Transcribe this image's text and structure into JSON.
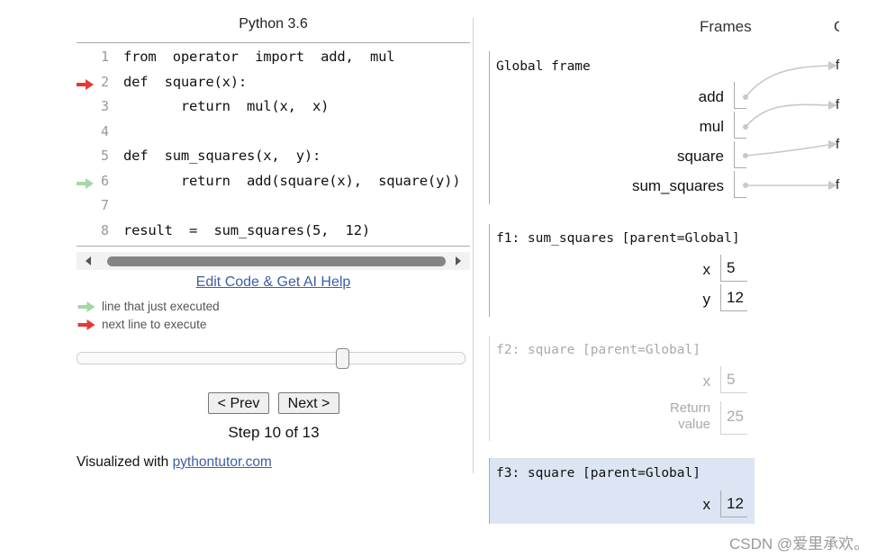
{
  "code_panel": {
    "language_title": "Python 3.6",
    "lines": [
      {
        "num": "1",
        "text": "from  operator  import  add,  mul",
        "arrow": "none"
      },
      {
        "num": "2",
        "text": "def  square(x):",
        "arrow": "next"
      },
      {
        "num": "3",
        "text": "       return  mul(x,  x)",
        "arrow": "none"
      },
      {
        "num": "4",
        "text": "",
        "arrow": "none"
      },
      {
        "num": "5",
        "text": "def  sum_squares(x,  y):",
        "arrow": "none"
      },
      {
        "num": "6",
        "text": "       return  add(square(x),  square(y))",
        "arrow": "just_executed"
      },
      {
        "num": "7",
        "text": "",
        "arrow": "none"
      },
      {
        "num": "8",
        "text": "result  =  sum_squares(5,  12)",
        "arrow": "none"
      }
    ],
    "edit_link": "Edit Code & Get AI Help",
    "legend": {
      "just_executed": "line that just executed",
      "next_to_execute": "next line to execute"
    },
    "prev_button": "< Prev",
    "next_button": "Next >",
    "step_text": "Step 10 of 13",
    "visualized_prefix": "Visualized with",
    "visualized_link": "pythontutor.com",
    "slider_fraction": 0.69
  },
  "frames_panel": {
    "title": "Frames",
    "objects_title_partial": "O",
    "global_frame": {
      "name": "Global frame",
      "vars": [
        "add",
        "mul",
        "square",
        "sum_squares"
      ]
    },
    "f1": {
      "name": "f1: sum_squares [parent=Global]",
      "vars": [
        {
          "name": "x",
          "value": "5"
        },
        {
          "name": "y",
          "value": "12"
        }
      ]
    },
    "f2": {
      "name": "f2: square [parent=Global]",
      "vars": [
        {
          "name": "x",
          "value": "5"
        }
      ],
      "return_label_1": "Return",
      "return_label_2": "value",
      "return_value": "25"
    },
    "f3": {
      "name": "f3: square [parent=Global]",
      "vars": [
        {
          "name": "x",
          "value": "12"
        }
      ]
    },
    "object_stubs": [
      "f",
      "f",
      "f",
      "f"
    ]
  },
  "colors": {
    "next_arrow": "#e53935",
    "just_executed_arrow": "#a5d6a7",
    "active_frame_bg": "#dbe5f3",
    "link": "#3a5fa9"
  },
  "watermark": "CSDN @爱里承欢。"
}
